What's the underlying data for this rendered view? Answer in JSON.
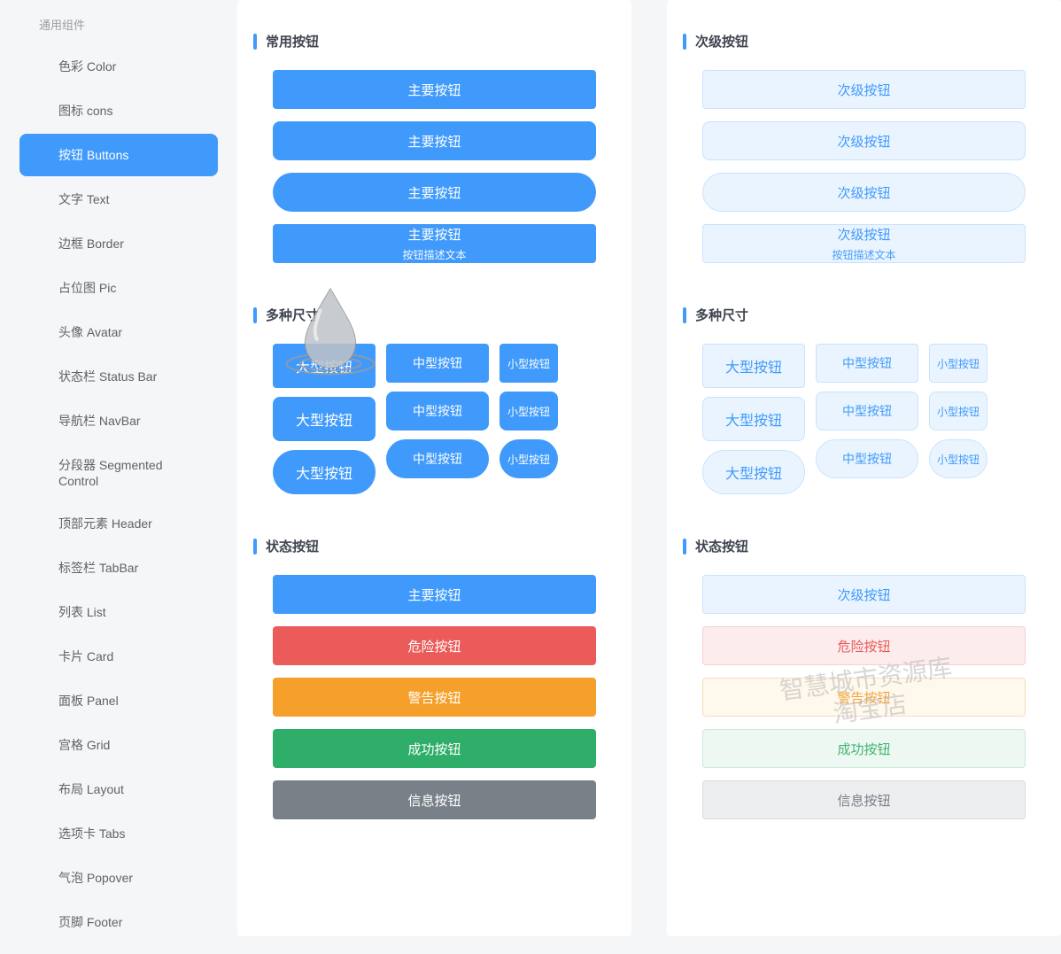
{
  "sidebar": {
    "header": "通用组件",
    "items": [
      {
        "label": "色彩 Color"
      },
      {
        "label": "图标 cons"
      },
      {
        "label": "按钮 Buttons",
        "active": true
      },
      {
        "label": "文字 Text"
      },
      {
        "label": "边框 Border"
      },
      {
        "label": "占位图  Pic"
      },
      {
        "label": "头像 Avatar"
      },
      {
        "label": "状态栏 Status Bar"
      },
      {
        "label": "导航栏 NavBar"
      },
      {
        "label": "分段器 Segmented Control"
      },
      {
        "label": "顶部元素 Header"
      },
      {
        "label": "标签栏 TabBar"
      },
      {
        "label": "列表 List"
      },
      {
        "label": "卡片 Card"
      },
      {
        "label": "面板 Panel"
      },
      {
        "label": "宫格 Grid"
      },
      {
        "label": "布局 Layout"
      },
      {
        "label": "选项卡 Tabs"
      },
      {
        "label": "气泡 Popover"
      },
      {
        "label": "页脚 Footer"
      }
    ]
  },
  "primary": {
    "section1": "常用按钮",
    "b1": "主要按钮",
    "b2": "主要按钮",
    "b3": "主要按钮",
    "b4": "主要按钮",
    "b4sub": "按钮描述文本",
    "section2": "多种尺寸",
    "lg": "大型按钮",
    "md": "中型按钮",
    "sm": "小型按钮",
    "section3": "状态按钮",
    "s_primary": "主要按钮",
    "s_danger": "危险按钮",
    "s_warning": "警告按钮",
    "s_success": "成功按钮",
    "s_info": "信息按钮"
  },
  "secondary": {
    "section1": "次级按钮",
    "b1": "次级按钮",
    "b2": "次级按钮",
    "b3": "次级按钮",
    "b4": "次级按钮",
    "b4sub": "按钮描述文本",
    "section2": "多种尺寸",
    "lg": "大型按钮",
    "md": "中型按钮",
    "sm": "小型按钮",
    "section3": "状态按钮",
    "s_secondary": "次级按钮",
    "s_danger": "危险按钮",
    "s_warning": "警告按钮",
    "s_success": "成功按钮",
    "s_info": "信息按钮"
  },
  "watermark": {
    "line1": "智慧城市资源库",
    "line2": "淘宝店"
  }
}
